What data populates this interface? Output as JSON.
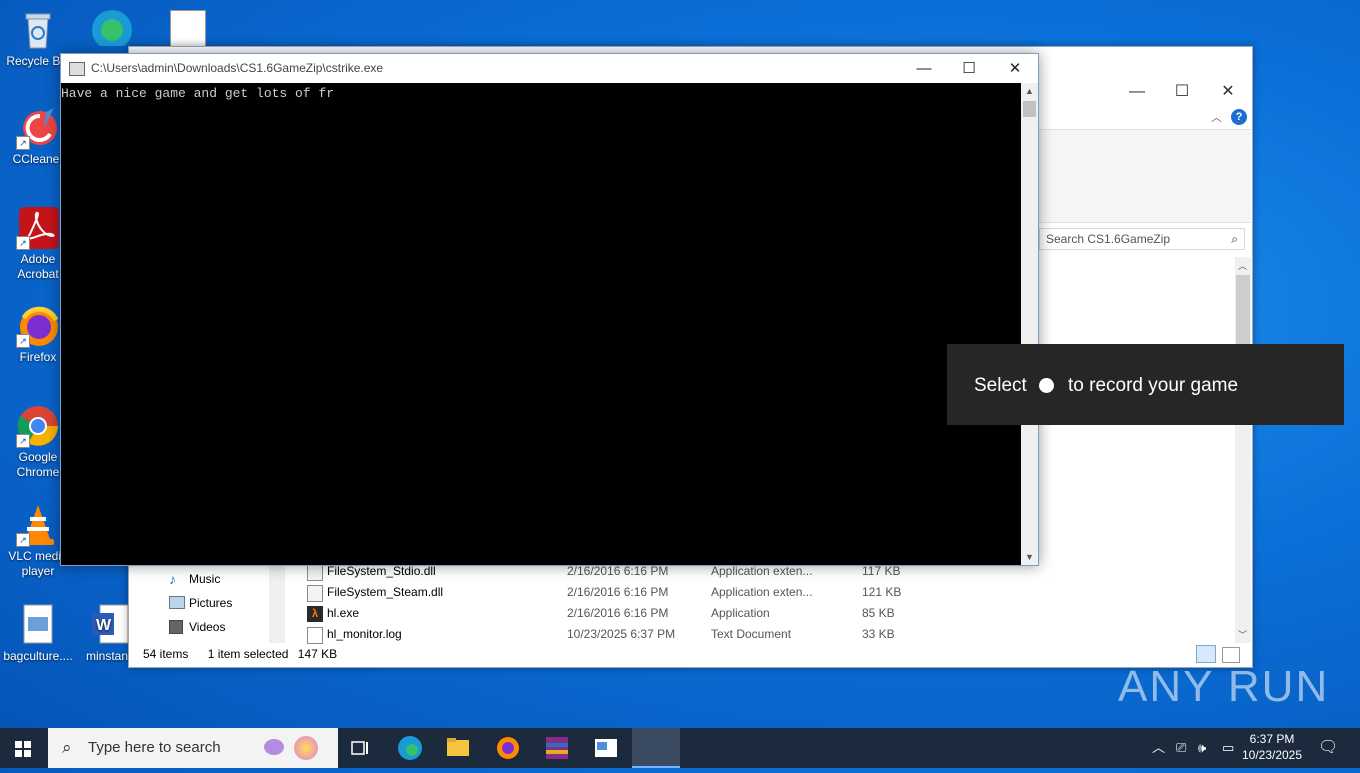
{
  "desktop": {
    "icons": [
      {
        "label": "Recycle Bin"
      },
      {
        "label": "CCleaner"
      },
      {
        "label": "Adobe Acrobat"
      },
      {
        "label": "Firefox"
      },
      {
        "label": "Google Chrome"
      },
      {
        "label": "VLC media player"
      },
      {
        "label": "bagculture...."
      },
      {
        "label": "minstanc"
      }
    ]
  },
  "console": {
    "title": "C:\\Users\\admin\\Downloads\\CS1.6GameZip\\cstrike.exe",
    "output": "Have a nice game and get lots of fr",
    "minimize": "—",
    "maximize": "☐",
    "close": "✕"
  },
  "explorer": {
    "search_placeholder": "Search CS1.6GameZip",
    "nav": [
      "Music",
      "Pictures",
      "Videos"
    ],
    "files": [
      {
        "name": "FileSystem_Stdio.dll",
        "date": "2/16/2016 6:16 PM",
        "type": "Application exten...",
        "size": "117 KB"
      },
      {
        "name": "FileSystem_Steam.dll",
        "date": "2/16/2016 6:16 PM",
        "type": "Application exten...",
        "size": "121 KB"
      },
      {
        "name": "hl.exe",
        "date": "2/16/2016 6:16 PM",
        "type": "Application",
        "size": "85 KB"
      },
      {
        "name": "hl_monitor.log",
        "date": "10/23/2025 6:37 PM",
        "type": "Text Document",
        "size": "33 KB"
      }
    ],
    "status": {
      "items": "54 items",
      "selected": "1 item selected",
      "size": "147 KB"
    }
  },
  "toast": {
    "before": "Select",
    "after": "to record your game"
  },
  "watermark": "ANY RUN",
  "taskbar": {
    "search_placeholder": "Type here to search",
    "time": "6:37 PM",
    "date": "10/23/2025"
  }
}
